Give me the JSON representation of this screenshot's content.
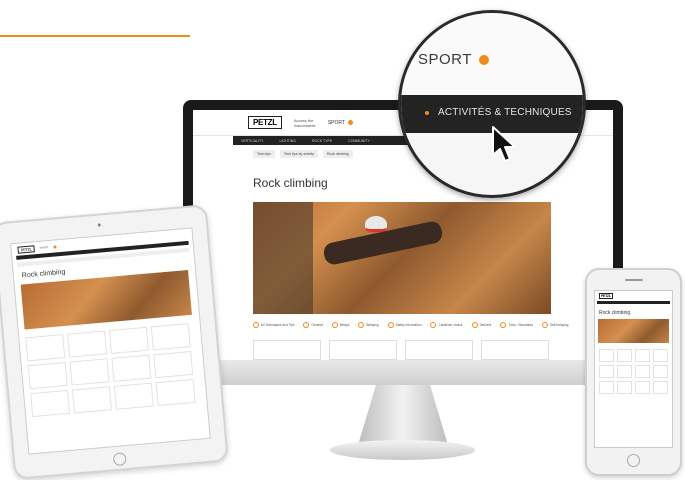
{
  "colors": {
    "accent": "#f08a1c",
    "nav_dark": "#222222"
  },
  "desktop": {
    "logo": "PETZL",
    "logo_tagline": "Access the inaccessible",
    "sport_label": "SPORT",
    "nav": [
      "VERTICALITY",
      "LIGHTING",
      "ROCK TYPE",
      "COMMUNITY"
    ],
    "breadcrumbs": [
      "Tech tips",
      "Tech tips by activity",
      "Rock climbing"
    ],
    "page_title": "Rock climbing",
    "filters": [
      "All Techniques and Tips",
      "General",
      "Belays",
      "Belaying",
      "Safety Information",
      "Carabiner choice",
      "Descent",
      "Tools / Standards",
      "Self-belaying"
    ]
  },
  "magnifier": {
    "sport_label": "SPORT",
    "activities_label": "ACTIVITÉS & TECHNIQUES",
    "cursor_icon": "pointer-cursor-icon"
  },
  "tablet": {
    "logo": "PETZL",
    "sport_label": "SPORT",
    "page_title": "Rock climbing"
  },
  "phone": {
    "logo": "PETZL",
    "page_title": "Rock climbing"
  }
}
